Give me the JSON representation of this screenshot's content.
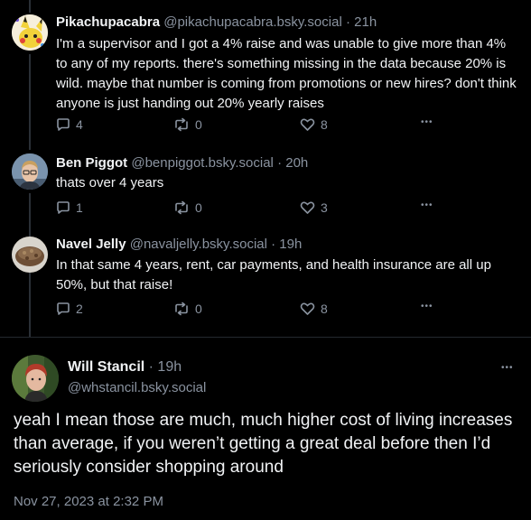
{
  "replies": [
    {
      "display_name": "Pikachupacabra",
      "handle": "@pikachupacabra.bsky.social",
      "time": "· 21h",
      "text": "I'm a supervisor and I got a 4% raise and was unable to give more than 4% to any of my reports. there's something missing in the data because 20% is wild. maybe that number is coming from promotions or new hires? don't think anyone is just handing out 20% yearly raises",
      "replies_count": "4",
      "reposts_count": "0",
      "likes_count": "8"
    },
    {
      "display_name": "Ben Piggot",
      "handle": "@benpiggot.bsky.social",
      "time": "· 20h",
      "text": "thats over 4 years",
      "replies_count": "1",
      "reposts_count": "0",
      "likes_count": "3"
    },
    {
      "display_name": "Navel Jelly",
      "handle": "@navaljelly.bsky.social",
      "time": "· 19h",
      "text": "In that same 4 years, rent, car payments, and health insurance are all up 50%, but that raise!",
      "replies_count": "2",
      "reposts_count": "0",
      "likes_count": "8"
    }
  ],
  "main": {
    "display_name": "Will Stancil",
    "time": "· 19h",
    "handle": "@whstancil.bsky.social",
    "text": "yeah I mean those are much, much higher cost of living increases than average, if you weren’t getting a great deal before then I’d seriously consider shopping around",
    "date": "Nov 27, 2023 at 2:32 PM",
    "more": "•••"
  },
  "icons": {
    "reply": "reply-icon",
    "repost": "repost-icon",
    "like": "heart-icon",
    "more": "more-icon"
  },
  "colors": {
    "background": "#000000",
    "text": "#f1f3f5",
    "muted": "#8a93a0",
    "thread_line": "#2a2f36"
  }
}
